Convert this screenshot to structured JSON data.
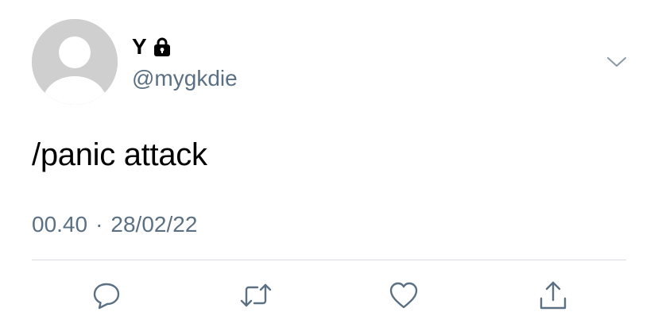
{
  "tweet": {
    "author": {
      "display_name": "Y",
      "handle": "@mygkdie",
      "protected_icon": "lock-icon"
    },
    "menu_icon": "chevron-down-icon",
    "text": "/panic attack",
    "time": "00.40",
    "separator": "·",
    "date": "28/02/22"
  },
  "actions": [
    {
      "name": "reply",
      "icon": "reply-icon"
    },
    {
      "name": "retweet",
      "icon": "retweet-icon"
    },
    {
      "name": "like",
      "icon": "heart-icon"
    },
    {
      "name": "share",
      "icon": "share-icon"
    }
  ],
  "colors": {
    "text_primary": "#000000",
    "text_secondary": "#5b7083",
    "avatar_bg": "#cfcfcf",
    "divider": "#d9dde1"
  }
}
